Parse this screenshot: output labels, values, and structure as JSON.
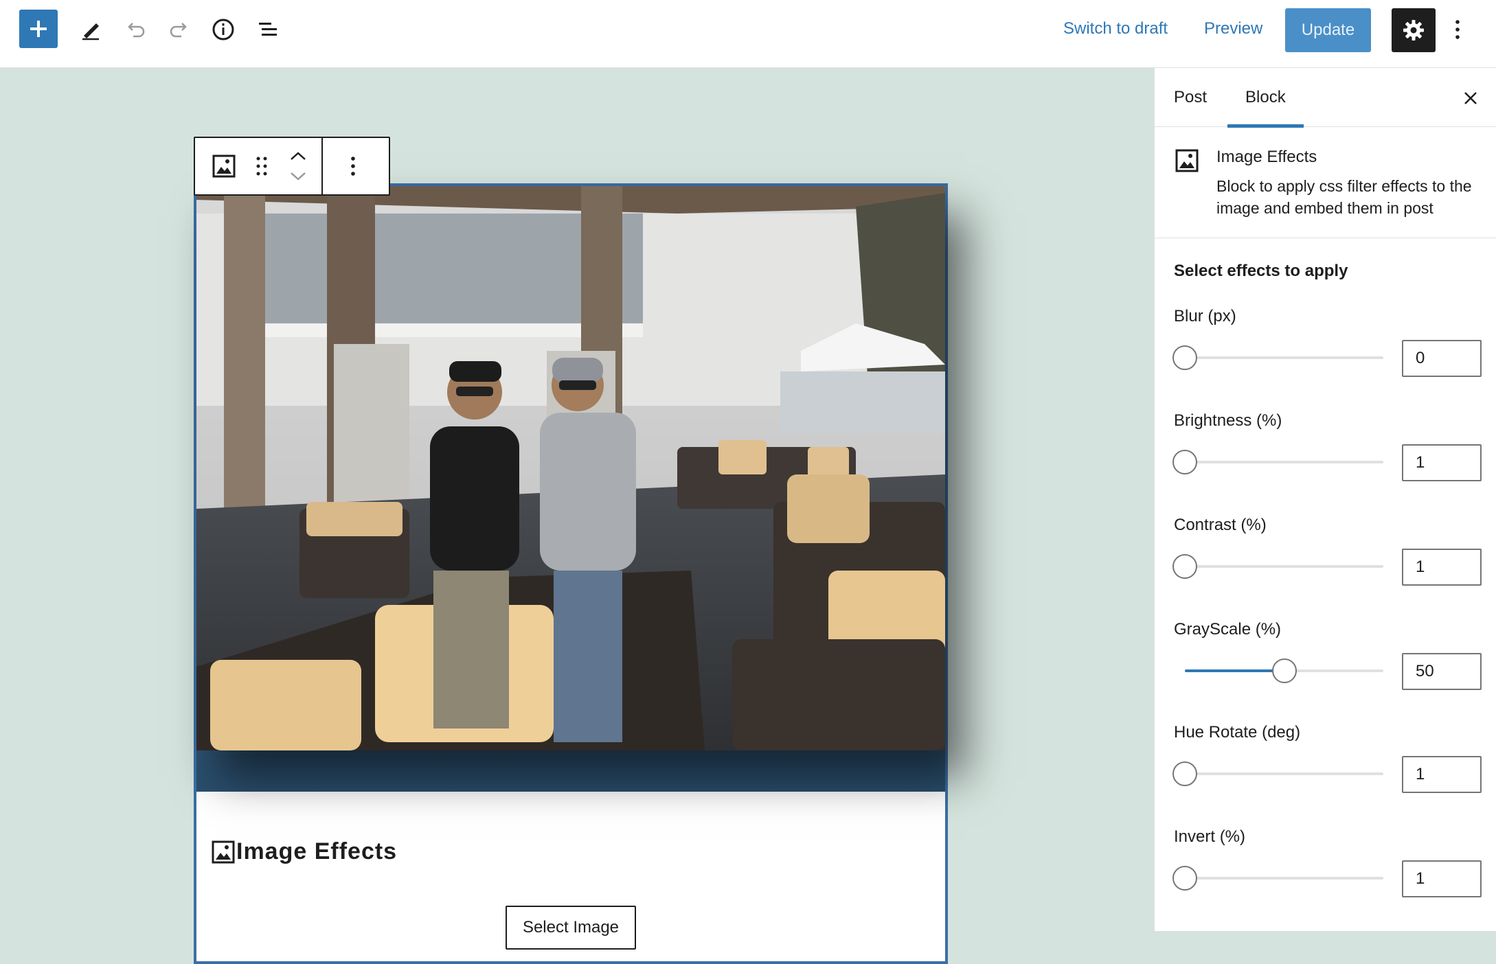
{
  "header": {
    "switch_to_draft": "Switch to draft",
    "preview": "Preview",
    "update": "Update"
  },
  "canvas": {
    "block_title": "Image Effects",
    "select_image": "Select Image",
    "background_color": "#d4e3dd"
  },
  "sidebar": {
    "tabs": [
      {
        "label": "Post",
        "active": false
      },
      {
        "label": "Block",
        "active": true
      }
    ],
    "block_card": {
      "title": "Image Effects",
      "description": "Block to apply css filter effects to the image and embed them in post"
    },
    "panel_heading": "Select effects to apply",
    "controls": [
      {
        "label": "Blur (px)",
        "value": "0",
        "level": 0
      },
      {
        "label": "Brightness (%)",
        "value": "1",
        "level": 0
      },
      {
        "label": "Contrast (%)",
        "value": "1",
        "level": 0
      },
      {
        "label": "GrayScale (%)",
        "value": "50",
        "level": 0.5
      },
      {
        "label": "Hue Rotate (deg)",
        "value": "1",
        "level": 0
      },
      {
        "label": "Invert (%)",
        "value": "1",
        "level": 0
      }
    ]
  },
  "colors": {
    "accent": "#2e78b5",
    "update_button": "#4a8fc8",
    "dark": "#1e1e1e"
  },
  "icons": [
    "plus-icon",
    "pencil-icon",
    "undo-icon",
    "redo-icon",
    "info-icon",
    "list-view-icon",
    "gear-icon",
    "more-vertical-icon",
    "image-icon",
    "drag-handle-icon",
    "chevron-up-icon",
    "chevron-down-icon",
    "close-icon"
  ]
}
